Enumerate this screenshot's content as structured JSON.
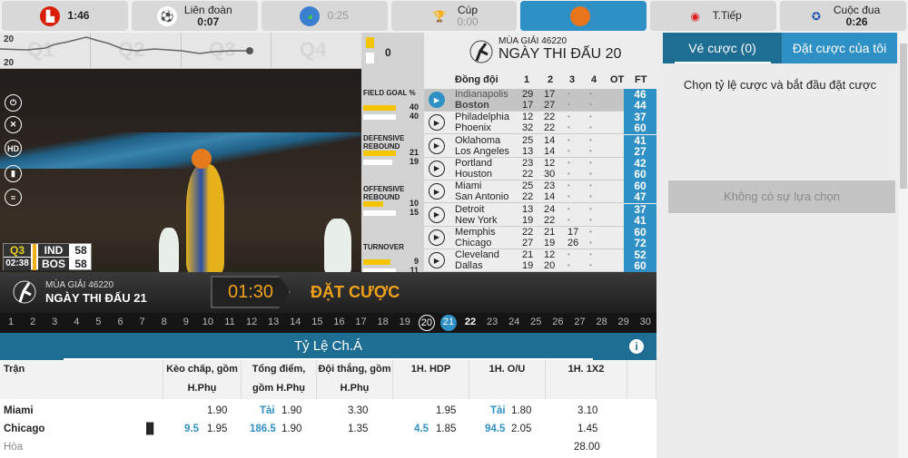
{
  "topbar": {
    "tabs": [
      {
        "label": "",
        "time": "1:46",
        "icon": "bundesliga-logo-icon"
      },
      {
        "label": "Liên đoàn",
        "time": "0:07",
        "icon": "soccer-ball-icon"
      },
      {
        "label": "",
        "time": "0:25",
        "icon": "globe-soccer-icon"
      },
      {
        "label": "Cúp",
        "time": "0:00",
        "icon": "trophy-icon"
      },
      {
        "label": "",
        "time": "",
        "icon": "basketball-icon",
        "active": true
      },
      {
        "label": "T.Tiếp",
        "time": "",
        "icon": "live-icon"
      },
      {
        "label": "Cuộc đua",
        "time": "0:26",
        "icon": "ribbon-icon"
      }
    ]
  },
  "video": {
    "chart": {
      "top": "20",
      "bottom": "20",
      "quarters": [
        "Q1",
        "Q2",
        "Q3",
        "Q4"
      ]
    },
    "score": {
      "quarter": "Q3",
      "clock": "02:38",
      "home": "IND",
      "home_score": "58",
      "away": "BOS",
      "away_score": "58"
    }
  },
  "stats": {
    "possession": "0",
    "items": [
      {
        "label": "FIELD GOAL %",
        "home": "40",
        "away": "40",
        "hf": 0.9,
        "af": 0.9
      },
      {
        "label": "DEFENSIVE REBOUND",
        "home": "21",
        "away": "19",
        "hf": 0.9,
        "af": 0.8
      },
      {
        "label": "OFFENSIVE REBOUND",
        "home": "10",
        "away": "15",
        "hf": 0.55,
        "af": 0.9
      },
      {
        "label": "TURNOVER",
        "home": "9",
        "away": "11",
        "hf": 0.75,
        "af": 0.9
      }
    ]
  },
  "board": {
    "season": "MÙA GIẢI 46220",
    "day": "NGÀY THI ĐẤU 20",
    "headers": [
      "Đồng đội",
      "1",
      "2",
      "3",
      "4",
      "OT",
      "FT"
    ],
    "games": [
      {
        "t1": "Indianapolis",
        "t2": "Boston",
        "s1": [
          "29",
          "17",
          "•",
          "•",
          ""
        ],
        "s2": [
          "17",
          "27",
          "•",
          "•",
          ""
        ],
        "ft1": "46",
        "ft2": "44"
      },
      {
        "t1": "Philadelphia",
        "t2": "Phoenix",
        "s1": [
          "12",
          "22",
          "•",
          "•",
          ""
        ],
        "s2": [
          "32",
          "22",
          "•",
          "•",
          ""
        ],
        "ft1": "37",
        "ft2": "60"
      },
      {
        "t1": "Oklahoma",
        "t2": "Los Angeles",
        "s1": [
          "25",
          "14",
          "•",
          "•",
          ""
        ],
        "s2": [
          "13",
          "14",
          "•",
          "•",
          ""
        ],
        "ft1": "41",
        "ft2": "27"
      },
      {
        "t1": "Portland",
        "t2": "Houston",
        "s1": [
          "23",
          "12",
          "•",
          "•",
          ""
        ],
        "s2": [
          "22",
          "30",
          "•",
          "•",
          ""
        ],
        "ft1": "42",
        "ft2": "60"
      },
      {
        "t1": "Miami",
        "t2": "San Antonio",
        "s1": [
          "25",
          "23",
          "•",
          "•",
          ""
        ],
        "s2": [
          "22",
          "14",
          "•",
          "•",
          ""
        ],
        "ft1": "60",
        "ft2": "47"
      },
      {
        "t1": "Detroit",
        "t2": "New York",
        "s1": [
          "13",
          "24",
          "•",
          "•",
          ""
        ],
        "s2": [
          "19",
          "22",
          "•",
          "•",
          ""
        ],
        "ft1": "37",
        "ft2": "41"
      },
      {
        "t1": "Memphis",
        "t2": "Chicago",
        "s1": [
          "22",
          "21",
          "17",
          "•",
          ""
        ],
        "s2": [
          "27",
          "19",
          "26",
          "•",
          ""
        ],
        "ft1": "60",
        "ft2": "72"
      },
      {
        "t1": "Cleveland",
        "t2": "Dallas",
        "s1": [
          "21",
          "12",
          "•",
          "•",
          ""
        ],
        "s2": [
          "19",
          "20",
          "•",
          "•",
          ""
        ],
        "ft1": "52",
        "ft2": "60"
      }
    ]
  },
  "next": {
    "season": "MÙA GIẢI 46220",
    "day": "NGÀY THI ĐẤU 21",
    "countdown": "01:30",
    "bet_label": "ĐẶT CƯỢC"
  },
  "days": {
    "list": [
      "1",
      "2",
      "3",
      "4",
      "5",
      "6",
      "7",
      "8",
      "9",
      "10",
      "11",
      "12",
      "13",
      "14",
      "15",
      "16",
      "17",
      "18",
      "19",
      "20",
      "21",
      "22",
      "23",
      "24",
      "25",
      "26",
      "27",
      "28",
      "29",
      "30"
    ],
    "current": "20",
    "selected": "21"
  },
  "odds": {
    "title": "Tỷ Lệ Ch.Á",
    "headers": [
      "Trận",
      "Kèo chấp, gồm H.Phụ",
      "Tổng điểm, gồm H.Phụ",
      "Đội thắng, gồm H.Phụ",
      "1H. HDP",
      "1H. O/U",
      "1H. 1X2"
    ],
    "home": "Miami",
    "away": "Chicago",
    "draw": "Hòa",
    "hdp": {
      "line": "9.5",
      "home": "1.90",
      "away": "1.95"
    },
    "ou": {
      "over": "Tài",
      "line": "186.5",
      "home": "1.90",
      "away": "1.90"
    },
    "ml": {
      "home": "3.30",
      "away": "1.35"
    },
    "h1hdp": {
      "line": "4.5",
      "home": "1.95",
      "away": "1.85"
    },
    "h1ou": {
      "over": "Tài",
      "line": "94.5",
      "home": "1.80",
      "away": "2.05"
    },
    "h1x2": {
      "home": "3.10",
      "away": "1.45",
      "draw": "28.00"
    }
  },
  "betslip": {
    "tab1": "Vé cược (0)",
    "tab2": "Đặt cược của tôi",
    "prompt": "Chọn tỷ lệ cược và bắt đầu đặt cược",
    "empty_button": "Không có sự lựa chọn"
  },
  "colors": {
    "accent": "#2e90c4",
    "dark_blue": "#1e6d92",
    "gold": "#f0a21a"
  }
}
